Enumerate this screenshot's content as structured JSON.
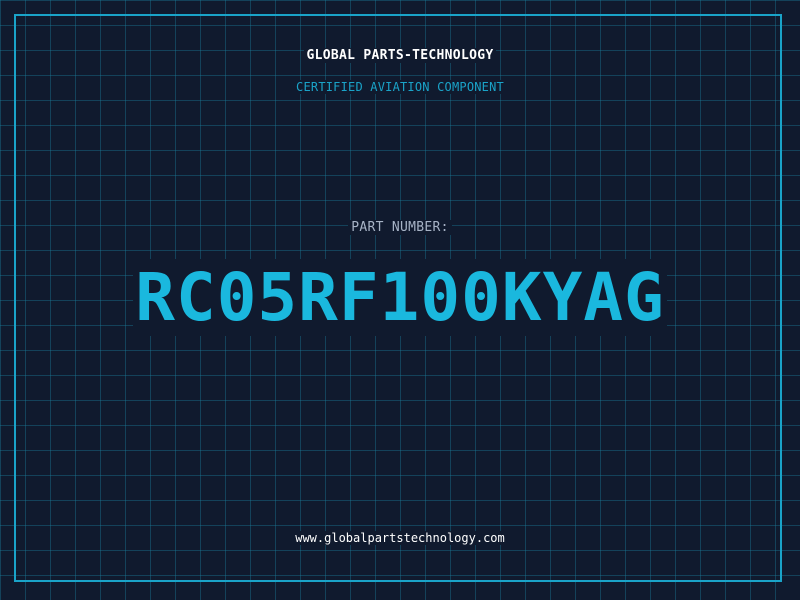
{
  "header": {
    "company_name": "GLOBAL PARTS-TECHNOLOGY",
    "subtitle": "CERTIFIED AVIATION COMPONENT"
  },
  "part": {
    "label": "PART NUMBER:",
    "number": "RC05RF100KYAG"
  },
  "footer": {
    "website": "www.globalpartstechnology.com"
  },
  "colors": {
    "background": "#101a2e",
    "grid": "#1b82a0",
    "accent": "#1aa3c8",
    "part_number": "#1ab8de",
    "label": "#a7b3c6",
    "text": "#ffffff"
  }
}
